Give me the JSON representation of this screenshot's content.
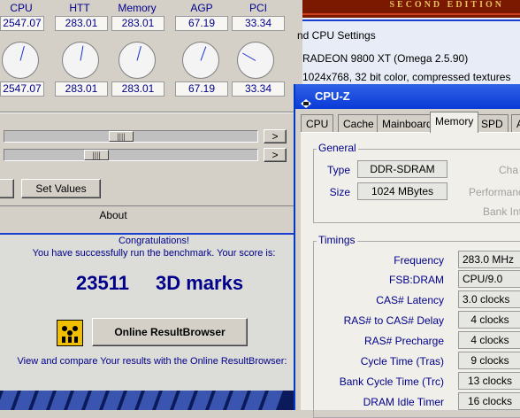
{
  "clock": {
    "headers": [
      "CPU",
      "HTT",
      "Memory",
      "AGP",
      "PCI"
    ],
    "current": [
      "2547.07",
      "283.01",
      "283.01",
      "67.19",
      "33.34"
    ],
    "target": [
      "2547.07",
      "283.01",
      "283.01",
      "67.19",
      "33.34"
    ],
    "dial_angles_deg": [
      -75,
      -80,
      -75,
      -70,
      -150
    ],
    "slider_arrow": ">",
    "set_values_label": "Set Values",
    "about_label": "About"
  },
  "result": {
    "line1": "Congratulations!",
    "line2": "You have successfully run the benchmark. Your score is:",
    "score": "23511",
    "score_unit": "3D marks",
    "online_button": "Online ResultBrowser",
    "footer": "View and compare Your results with the Online ResultBrowser:"
  },
  "gpu_info": {
    "banner_text": "SECOND EDITION",
    "settings_header": "nd CPU Settings",
    "adapter": "RADEON 9800 XT (Omega 2.5.90)",
    "mode": "1024x768, 32 bit color, compressed textures"
  },
  "cpuz": {
    "title": "CPU-Z",
    "tabs": [
      "CPU",
      "Cache",
      "Mainboard",
      "Memory",
      "SPD",
      "A"
    ],
    "active_tab": "Memory",
    "general": {
      "label": "General",
      "type_label": "Type",
      "type_value": "DDR-SDRAM",
      "size_label": "Size",
      "size_value": "1024 MBytes",
      "channels_label": "Cha",
      "performance_label": "Performance",
      "bank_label": "Bank Int"
    },
    "timings": {
      "label": "Timings",
      "rows": [
        {
          "label": "Frequency",
          "value": "283.0 MHz"
        },
        {
          "label": "FSB:DRAM",
          "value": "CPU/9.0"
        },
        {
          "label": "CAS# Latency",
          "value": "3.0 clocks"
        },
        {
          "label": "RAS# to CAS# Delay",
          "value": "4 clocks"
        },
        {
          "label": "RAS# Precharge",
          "value": "4 clocks"
        },
        {
          "label": "Cycle Time (Tras)",
          "value": "9 clocks"
        },
        {
          "label": "Bank Cycle Time (Trc)",
          "value": "13 clocks"
        },
        {
          "label": "DRAM Idle Timer",
          "value": "16 clocks"
        }
      ]
    }
  },
  "colors": {
    "xp_title_blue": "#0a3ad6",
    "label_navy": "#00008b",
    "window_face": "#d4d0c8"
  }
}
